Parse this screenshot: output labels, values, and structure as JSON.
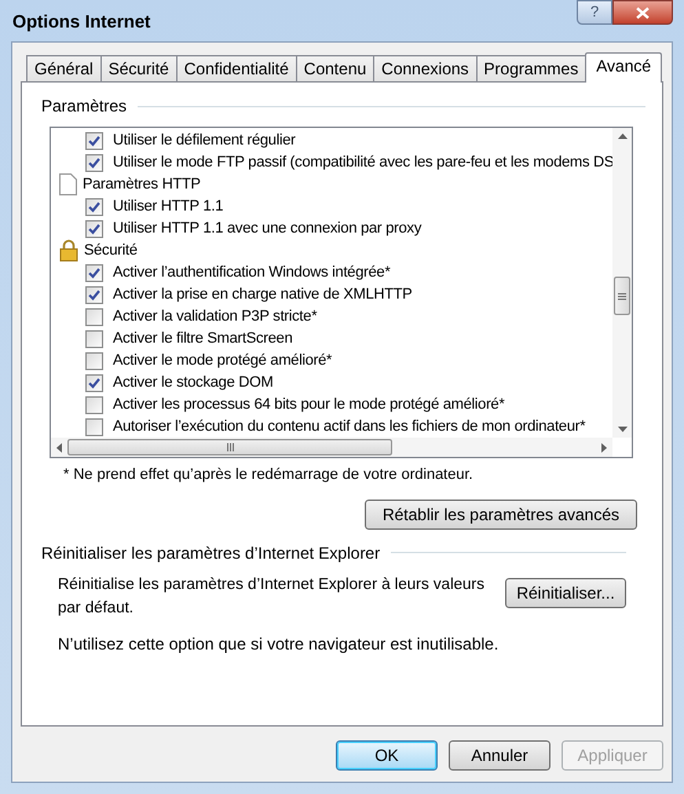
{
  "window": {
    "title": "Options Internet",
    "help": "?"
  },
  "tabs": [
    {
      "label": "Général",
      "selected": false
    },
    {
      "label": "Sécurité",
      "selected": false
    },
    {
      "label": "Confidentialité",
      "selected": false
    },
    {
      "label": "Contenu",
      "selected": false
    },
    {
      "label": "Connexions",
      "selected": false
    },
    {
      "label": "Programmes",
      "selected": false
    },
    {
      "label": "Avancé",
      "selected": true
    }
  ],
  "settings": {
    "title": "Paramètres",
    "items": [
      {
        "kind": "checkbox",
        "label": "Utiliser le défilement régulier",
        "checked": true
      },
      {
        "kind": "checkbox",
        "label": "Utiliser le mode FTP passif (compatibilité avec les pare-feu et les modems DS",
        "checked": true
      },
      {
        "kind": "page",
        "label": "Paramètres HTTP"
      },
      {
        "kind": "checkbox",
        "label": "Utiliser HTTP 1.1",
        "checked": true
      },
      {
        "kind": "checkbox",
        "label": "Utiliser HTTP 1.1 avec une connexion par proxy",
        "checked": true
      },
      {
        "kind": "lock",
        "label": "Sécurité"
      },
      {
        "kind": "checkbox",
        "label": "Activer l’authentification Windows intégrée*",
        "checked": true
      },
      {
        "kind": "checkbox",
        "label": "Activer la prise en charge native de XMLHTTP",
        "checked": true
      },
      {
        "kind": "checkbox",
        "label": "Activer la validation P3P stricte*",
        "checked": false
      },
      {
        "kind": "checkbox",
        "label": "Activer le filtre SmartScreen",
        "checked": false
      },
      {
        "kind": "checkbox",
        "label": "Activer le mode protégé amélioré*",
        "checked": false
      },
      {
        "kind": "checkbox",
        "label": "Activer le stockage DOM",
        "checked": true
      },
      {
        "kind": "checkbox",
        "label": "Activer les processus 64 bits pour le mode protégé amélioré*",
        "checked": false
      },
      {
        "kind": "checkbox",
        "label": "Autoriser l’exécution du contenu actif dans les fichiers de mon ordinateur*",
        "checked": false
      }
    ],
    "footnote": "* Ne prend effet qu’après le redémarrage de votre ordinateur.",
    "restore_button": "Rétablir les paramètres avancés"
  },
  "reset": {
    "title": "Réinitialiser les paramètres d’Internet Explorer",
    "description": "Réinitialise les paramètres d’Internet Explorer à leurs valeurs par défaut.",
    "button": "Réinitialiser...",
    "note": "N’utilisez cette option que si votre navigateur est inutilisable."
  },
  "buttons": [
    {
      "label": "OK",
      "default": true,
      "disabled": false
    },
    {
      "label": "Annuler",
      "default": false,
      "disabled": false
    },
    {
      "label": "Appliquer",
      "default": false,
      "disabled": true
    }
  ]
}
